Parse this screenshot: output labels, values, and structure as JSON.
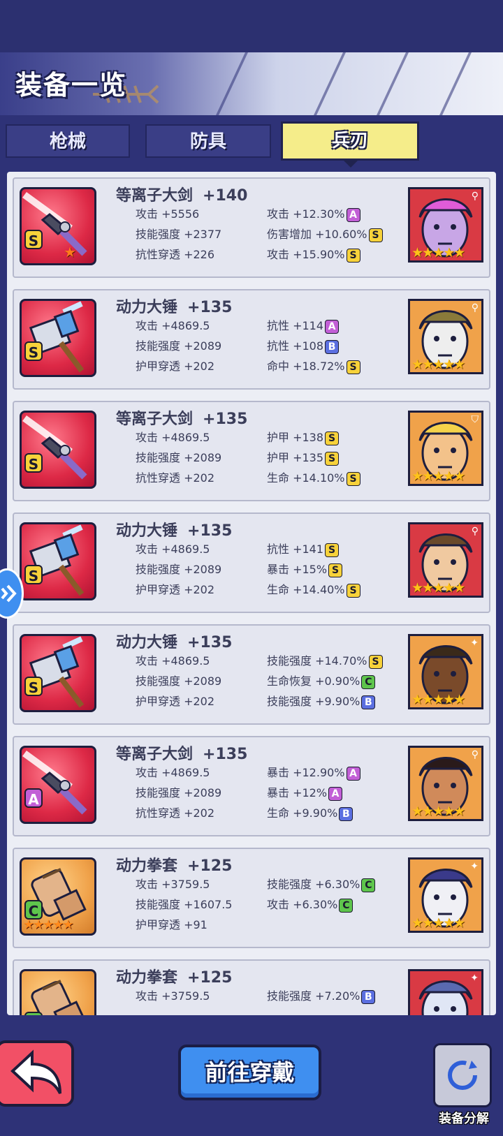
{
  "header": {
    "title": "装备一览"
  },
  "tabs": [
    {
      "label": "枪械",
      "active": false
    },
    {
      "label": "防具",
      "active": false
    },
    {
      "label": "兵刃",
      "active": true
    }
  ],
  "items": [
    {
      "name": "等离子大剑",
      "plus": "+140",
      "weapon": "sword",
      "grade": "S",
      "thumb": "red",
      "base": [
        {
          "icon": "sword-icon",
          "label": "攻击 +5556"
        },
        {
          "icon": "skill-wand-icon",
          "label": "技能强度 +2377"
        },
        {
          "icon": "resist-pen-icon",
          "label": "抗性穿透 +226"
        }
      ],
      "bonus": [
        {
          "icon": "sword-icon",
          "label": "攻击 +12.30%",
          "grade": "A"
        },
        {
          "icon": "damage-boost-icon",
          "label": "伤害增加 +10.60%",
          "grade": "S"
        },
        {
          "icon": "sword-icon",
          "label": "攻击 +15.90%",
          "grade": "S"
        }
      ],
      "hero": {
        "bg": "#d93a44",
        "skin": "#c8a6e6",
        "hair": "#e05cd8",
        "stars": "★★★★★",
        "tag": "⚲"
      }
    },
    {
      "name": "动力大锤",
      "plus": "+135",
      "weapon": "hammer",
      "grade": "S",
      "thumb": "red",
      "base": [
        {
          "icon": "sword-icon",
          "label": "攻击 +4869.5"
        },
        {
          "icon": "skill-wand-icon",
          "label": "技能强度 +2089"
        },
        {
          "icon": "armor-pen-icon",
          "label": "护甲穿透 +202"
        }
      ],
      "bonus": [
        {
          "icon": "resist-icon",
          "label": "抗性 +114",
          "grade": "A"
        },
        {
          "icon": "resist-icon",
          "label": "抗性 +108",
          "grade": "B"
        },
        {
          "icon": "crosshair-icon",
          "label": "命中 +18.72%",
          "grade": "S"
        }
      ],
      "hero": {
        "bg": "#f0a24a",
        "skin": "#eeeeee",
        "hair": "#8a7a3a",
        "stars": "★★★★★",
        "tag": "⚲"
      }
    },
    {
      "name": "等离子大剑",
      "plus": "+135",
      "weapon": "sword",
      "grade": "S",
      "thumb": "red",
      "base": [
        {
          "icon": "sword-icon",
          "label": "攻击 +4869.5"
        },
        {
          "icon": "skill-wand-icon",
          "label": "技能强度 +2089"
        },
        {
          "icon": "resist-pen-icon",
          "label": "抗性穿透 +202"
        }
      ],
      "bonus": [
        {
          "icon": "armor-icon",
          "label": "护甲 +138",
          "grade": "S"
        },
        {
          "icon": "armor-icon",
          "label": "护甲 +135",
          "grade": "S"
        },
        {
          "icon": "heart-icon",
          "label": "生命 +14.10%",
          "grade": "S"
        }
      ],
      "hero": {
        "bg": "#f0a24a",
        "skin": "#f3c28a",
        "hair": "#f5d24a",
        "stars": "★★★★★",
        "tag": "⛉"
      }
    },
    {
      "name": "动力大锤",
      "plus": "+135",
      "weapon": "hammer",
      "grade": "S",
      "thumb": "red",
      "base": [
        {
          "icon": "sword-icon",
          "label": "攻击 +4869.5"
        },
        {
          "icon": "skill-wand-icon",
          "label": "技能强度 +2089"
        },
        {
          "icon": "armor-pen-icon",
          "label": "护甲穿透 +202"
        }
      ],
      "bonus": [
        {
          "icon": "resist-icon",
          "label": "抗性 +141",
          "grade": "S"
        },
        {
          "icon": "crit-icon",
          "label": "暴击 +15%",
          "grade": "S"
        },
        {
          "icon": "heart-icon",
          "label": "生命 +14.40%",
          "grade": "S"
        }
      ],
      "hero": {
        "bg": "#d93a44",
        "skin": "#f0c9a0",
        "hair": "#6a4a2a",
        "stars": "★★★★★",
        "tag": "⚲"
      }
    },
    {
      "name": "动力大锤",
      "plus": "+135",
      "weapon": "hammer",
      "grade": "S",
      "thumb": "red",
      "base": [
        {
          "icon": "sword-icon",
          "label": "攻击 +4869.5"
        },
        {
          "icon": "skill-wand-icon",
          "label": "技能强度 +2089"
        },
        {
          "icon": "armor-pen-icon",
          "label": "护甲穿透 +202"
        }
      ],
      "bonus": [
        {
          "icon": "skill-wand-icon",
          "label": "技能强度 +14.70%",
          "grade": "S"
        },
        {
          "icon": "regen-icon",
          "label": "生命恢复 +0.90%",
          "grade": "C"
        },
        {
          "icon": "skill-wand-icon",
          "label": "技能强度 +9.90%",
          "grade": "B"
        }
      ],
      "hero": {
        "bg": "#f0a24a",
        "skin": "#7a4a2a",
        "hair": "#3a2a1a",
        "stars": "★★★★★",
        "tag": "✦"
      }
    },
    {
      "name": "等离子大剑",
      "plus": "+135",
      "weapon": "sword",
      "grade": "A",
      "thumb": "red",
      "base": [
        {
          "icon": "sword-icon",
          "label": "攻击 +4869.5"
        },
        {
          "icon": "skill-wand-icon",
          "label": "技能强度 +2089"
        },
        {
          "icon": "resist-pen-icon",
          "label": "抗性穿透 +202"
        }
      ],
      "bonus": [
        {
          "icon": "crit-icon",
          "label": "暴击 +12.90%",
          "grade": "A"
        },
        {
          "icon": "crit-icon",
          "label": "暴击 +12%",
          "grade": "A"
        },
        {
          "icon": "heart-icon",
          "label": "生命 +9.90%",
          "grade": "B"
        }
      ],
      "hero": {
        "bg": "#f0a24a",
        "skin": "#d08a5a",
        "hair": "#2a1a1a",
        "stars": "★★★★★",
        "tag": "⚲"
      }
    },
    {
      "name": "动力拳套",
      "plus": "+125",
      "weapon": "gauntlet",
      "grade": "C",
      "thumb": "orange",
      "base": [
        {
          "icon": "sword-icon",
          "label": "攻击 +3759.5"
        },
        {
          "icon": "skill-wand-icon",
          "label": "技能强度 +1607.5"
        },
        {
          "icon": "armor-pen-icon",
          "label": "护甲穿透 +91"
        }
      ],
      "bonus": [
        {
          "icon": "skill-wand-icon",
          "label": "技能强度 +6.30%",
          "grade": "C"
        },
        {
          "icon": "sword-icon",
          "label": "攻击 +6.30%",
          "grade": "C"
        }
      ],
      "hero": {
        "bg": "#f0a24a",
        "skin": "#f0f0f5",
        "hair": "#3a3a8a",
        "stars": "★★★★★",
        "tag": "✦"
      }
    },
    {
      "name": "动力拳套",
      "plus": "+125",
      "weapon": "gauntlet",
      "grade": "C",
      "thumb": "orange",
      "base": [
        {
          "icon": "sword-icon",
          "label": "攻击 +3759.5"
        }
      ],
      "bonus": [
        {
          "icon": "skill-wand-icon",
          "label": "技能强度 +7.20%",
          "grade": "B"
        }
      ],
      "hero": {
        "bg": "#d93a44",
        "skin": "#e0e6f5",
        "hair": "#5a6ab0",
        "stars": "",
        "tag": "✦"
      }
    }
  ],
  "footer": {
    "goto_label": "前往穿戴",
    "dismantle_label": "装备分解"
  }
}
